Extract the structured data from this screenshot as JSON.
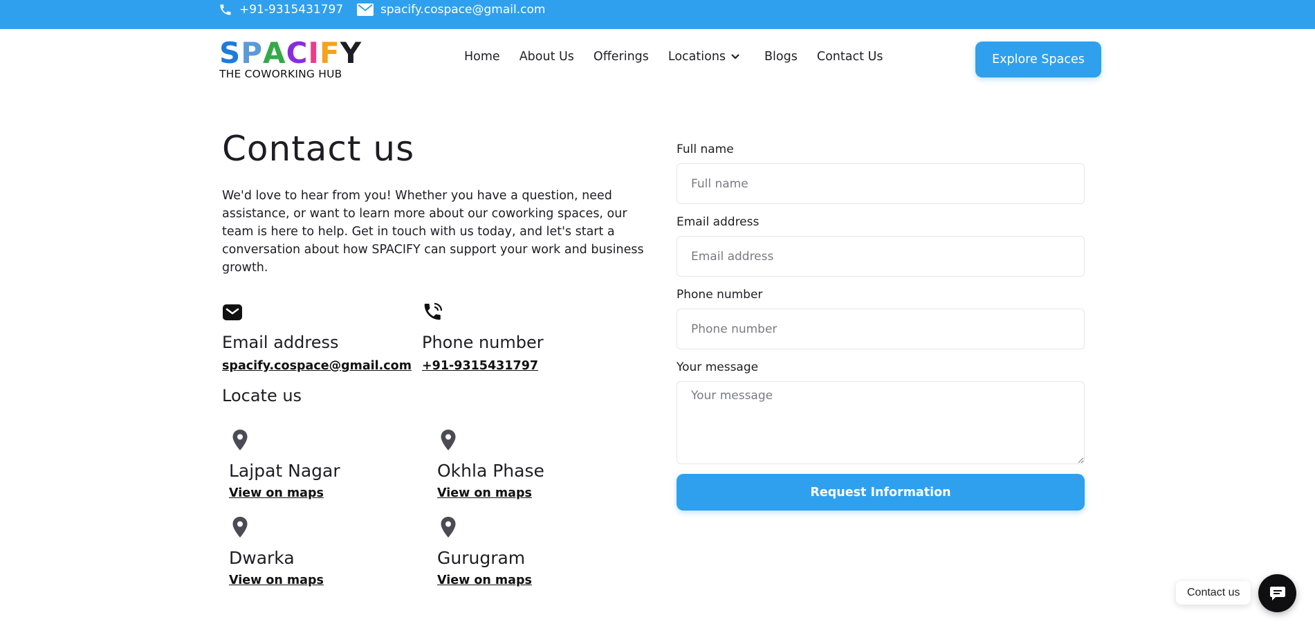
{
  "topbar": {
    "phone": "+91-9315431797",
    "email": "spacify.cospace@gmail.com"
  },
  "logo": {
    "letters": [
      "S",
      "P",
      "A",
      "C",
      "I",
      "F",
      "Y"
    ],
    "letter_colors": [
      "#1e7bd8",
      "#1e7bd8",
      "#35a94a",
      "#8a2be2",
      "#e83e8c",
      "#f7a21b",
      "#1d1d24"
    ],
    "tagline": "THE COWORKING HUB"
  },
  "nav": {
    "items": [
      "Home",
      "About Us",
      "Offerings",
      "Locations",
      "Blogs",
      "Contact Us"
    ],
    "explore_label": "Explore Spaces"
  },
  "contact": {
    "title": "Contact us",
    "intro": "We'd love to hear from you! Whether you have a question, need assistance, or want to learn more about our coworking spaces, our team is here to help. Get in touch with us today, and let's start a conversation about how SPACIFY can support your work and business growth.",
    "email_label": "Email address",
    "email_value": "spacify.cospace@gmail.com",
    "phone_label": "Phone number",
    "phone_value": "+91-9315431797",
    "locate_title": "Locate us",
    "locations": [
      {
        "name": "Lajpat Nagar",
        "link": "View on maps"
      },
      {
        "name": "Okhla Phase",
        "link": "View on maps"
      },
      {
        "name": "Dwarka",
        "link": "View on maps"
      },
      {
        "name": "Gurugram",
        "link": "View on maps"
      }
    ]
  },
  "form": {
    "full_name_label": "Full name",
    "full_name_placeholder": "Full name",
    "email_label": "Email address",
    "email_placeholder": "Email address",
    "phone_label": "Phone number",
    "phone_placeholder": "Phone number",
    "message_label": "Your message",
    "message_placeholder": "Your message",
    "submit_label": "Request Information"
  },
  "chat": {
    "label": "Contact us"
  },
  "colors": {
    "accent": "#2fa0ee"
  }
}
